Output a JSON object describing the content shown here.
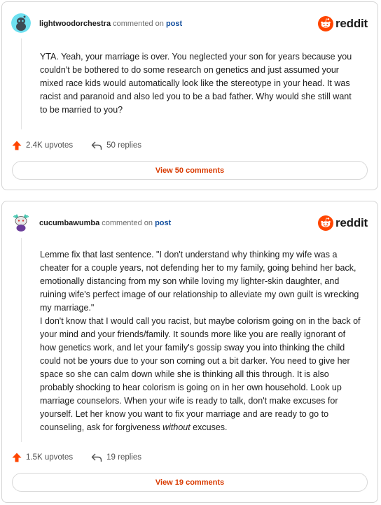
{
  "brand": {
    "name": "reddit",
    "color": "#ff4500"
  },
  "comments": [
    {
      "username": "lightwoodorchestra",
      "commented_on": "commented on",
      "post_link": "post",
      "avatar": "teal-snoo-avatar",
      "body": [
        "YTA. Yeah, your marriage is over. You neglected your son for years because you couldn't be bothered to do some research on genetics and just assumed your mixed race kids would automatically look like the stereotype in your head. It was racist and paranoid and also led you to be a bad father. Why would she still want to be married to you?"
      ],
      "upvotes": "2.4K upvotes",
      "replies": "50 replies",
      "view_label": "View 50 comments"
    },
    {
      "username": "cucumbawumba",
      "commented_on": "commented on",
      "post_link": "post",
      "avatar": "cat-snoo-avatar",
      "body": [
        "Lemme fix that last sentence. \"I don't understand why thinking my wife was a cheater for a couple years, not defending her to my family, going behind her back, emotionally distancing from my son while loving my lighter-skin daughter, and ruining wife's perfect image of our relationship to alleviate my own guilt is wrecking my marriage.\""
      ],
      "body_second_start": "I don't know that I would call you racist, but maybe colorism going on in the back of your mind and your friends/family. It sounds more like you are really ignorant of how genetics work, and let your family's gossip sway you into thinking the child could not be yours due to your son coming out a bit darker. You need to give her space so she can calm down while she is thinking all this through. It is also probably shocking to hear colorism is going on in her own household. Look up marriage counselors. When your wife is ready to talk, don't make excuses for yourself. Let her know you want to fix your marriage and are ready to go to counseling, ask for forgiveness ",
      "body_second_em": "without",
      "body_second_end": " excuses.",
      "upvotes": "1.5K upvotes",
      "replies": "19 replies",
      "view_label": "View 19 comments"
    }
  ]
}
